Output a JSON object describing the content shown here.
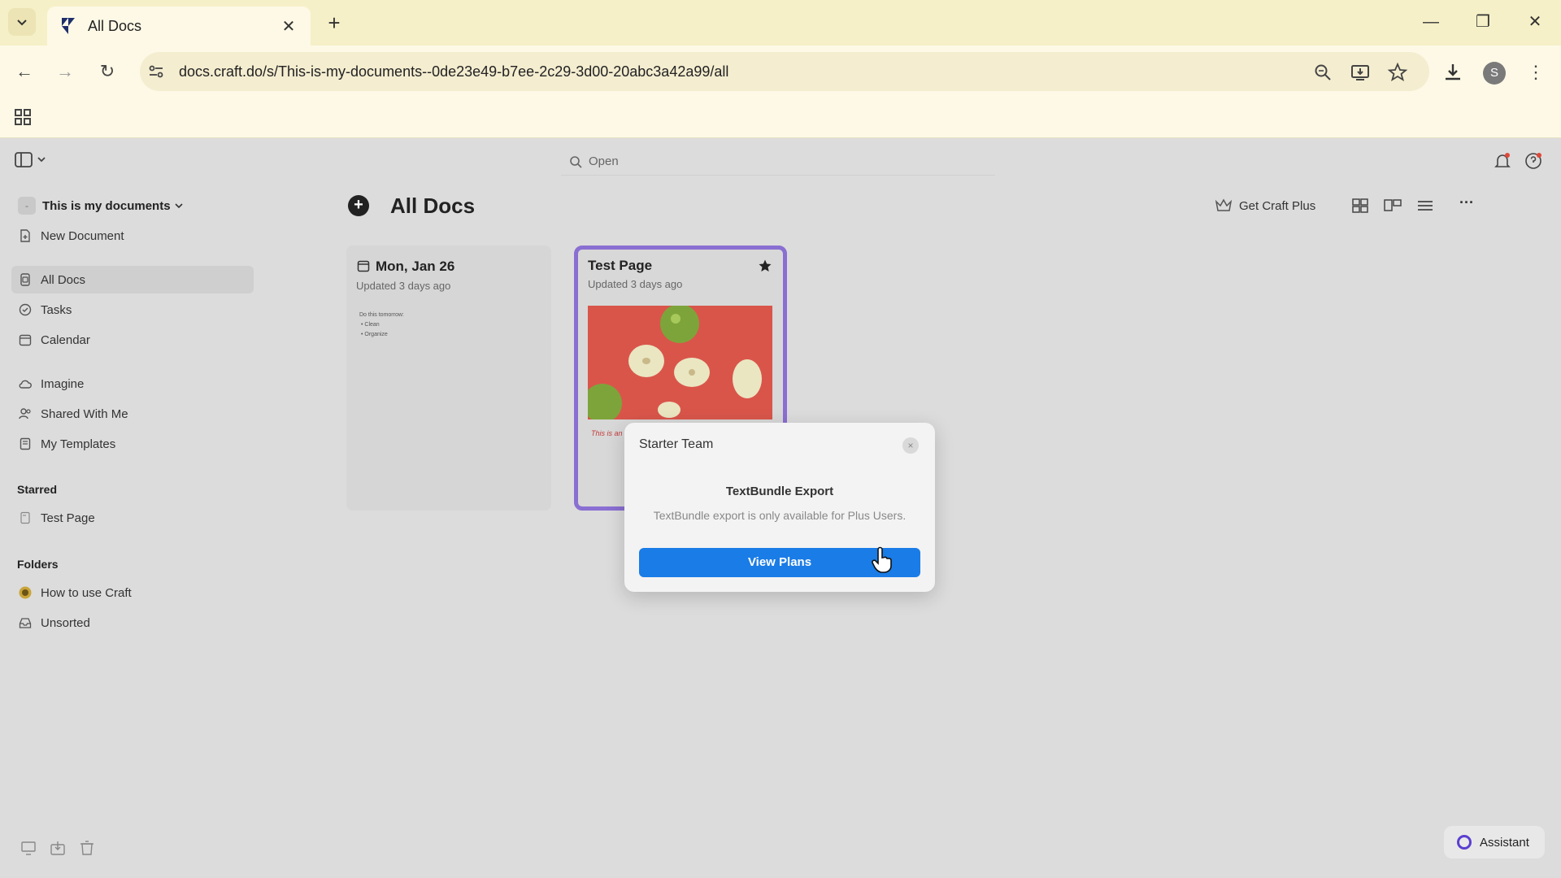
{
  "browser": {
    "tab_title": "All Docs",
    "url": "docs.craft.do/s/This-is-my-documents--0de23e49-b7ee-2c29-3d00-20abc3a42a99/all",
    "profile_initial": "S"
  },
  "sidebar": {
    "space_badge": "-",
    "space_name": "This is my documents",
    "new_document": "New Document",
    "items": [
      {
        "label": "All Docs",
        "icon": "docs-icon"
      },
      {
        "label": "Tasks",
        "icon": "tasks-icon"
      },
      {
        "label": "Calendar",
        "icon": "calendar-icon"
      },
      {
        "label": "Imagine",
        "icon": "cloud-icon"
      },
      {
        "label": "Shared With Me",
        "icon": "people-icon"
      },
      {
        "label": "My Templates",
        "icon": "template-icon"
      }
    ],
    "starred_heading": "Starred",
    "starred": [
      {
        "label": "Test Page"
      }
    ],
    "folders_heading": "Folders",
    "folders": [
      {
        "label": "How to use Craft"
      },
      {
        "label": "Unsorted"
      }
    ]
  },
  "search": {
    "placeholder": "Open"
  },
  "main": {
    "title": "All Docs",
    "get_plus": "Get Craft Plus",
    "more": "···"
  },
  "cards": [
    {
      "title": "Mon, Jan 26",
      "updated": "Updated 3 days ago",
      "preview": [
        "Do this tomorrow:",
        "• Clean",
        "• Organize"
      ]
    },
    {
      "title": "Test Page",
      "updated": "Updated 3 days ago",
      "snippet": "This is an"
    }
  ],
  "modal": {
    "title": "Starter Team",
    "close": "×",
    "heading": "TextBundle Export",
    "body": "TextBundle export is only available for Plus Users.",
    "cta": "View Plans"
  },
  "assistant": {
    "label": "Assistant"
  },
  "colors": {
    "accent": "#1a7ce6",
    "card_highlight": "#8a6fd2",
    "chrome": "#f6f0c8"
  }
}
